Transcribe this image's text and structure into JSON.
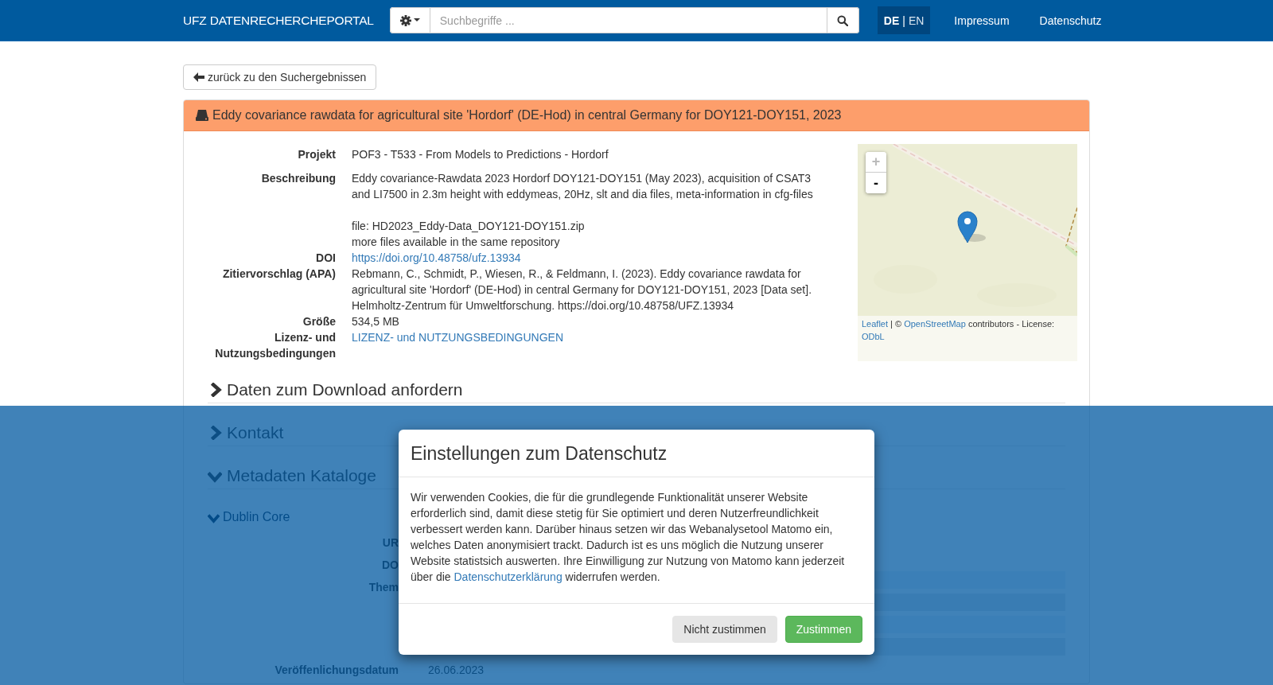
{
  "navbar": {
    "brand": "UFZ DATENRECHERCHEPORTAL",
    "search": {
      "placeholder": "Suchbegriffe ..."
    },
    "languages": [
      {
        "label": "DE",
        "selected": true
      },
      {
        "label": "EN",
        "selected": false
      }
    ],
    "language_separator": "|",
    "links": [
      "Impressum",
      "Datenschutz"
    ]
  },
  "back_button": "zurück zu den Suchergebnissen",
  "dataset": {
    "title": "Eddy covariance rawdata for agricultural site 'Hordorf' (DE-Hod) in central Germany for DOY121-DOY151, 2023",
    "fields": [
      {
        "kind": "text",
        "label": "Projekt",
        "value": "POF3 - T533 - From Models to Predictions - Hordorf"
      },
      {
        "kind": "description",
        "label": "Beschreibung",
        "paragraphs": [
          [
            "Eddy covariance-Rawdata 2023 Hordorf DOY121-DOY151 (May 2023), acquisition of CSAT3 and LI7500 in 2.3m height with eddymeas, 20Hz, slt and dia files, meta-information in cfg-files"
          ],
          [
            "file: HD2023_Eddy-Data_DOY121-DOY151.zip",
            "more files available in the same repository"
          ]
        ]
      },
      {
        "kind": "link",
        "label": "DOI",
        "value": "https://doi.org/10.48758/ufz.13934"
      },
      {
        "kind": "text",
        "label": "Zitiervorschlag (APA)",
        "value": "Rebmann, C., Schmidt, P., Wiesen, R., & Feldmann, I. (2023). Eddy covariance rawdata for agricultural site 'Hordorf' (DE-Hod) in central Germany for DOY121-DOY151, 2023 [Data set]. Helmholtz-Zentrum für Umweltforschung. https://doi.org/10.48758/UFZ.13934"
      },
      {
        "kind": "text",
        "label": "Größe",
        "value": "534,5 MB"
      },
      {
        "kind": "link",
        "label": "Lizenz- und Nutzungsbedingungen",
        "value": "LIZENZ- und NUTZUNGSBEDINGUNGEN"
      }
    ],
    "map": {
      "zoom_in": "+",
      "zoom_out": "-",
      "attribution": {
        "link1": "Leaflet",
        "middle": " | © ",
        "link2": "OpenStreetMap",
        "after": " contributors - License: ",
        "link3": "ODbL"
      }
    },
    "sections": [
      {
        "title": "Daten zum Download anfordern",
        "expanded": false
      },
      {
        "title": "Kontakt",
        "expanded": false
      },
      {
        "title": "Metadaten Kataloge",
        "expanded": true
      }
    ],
    "subsection": {
      "title": "Dublin Core",
      "expanded": true
    },
    "metadata_rows": [
      {
        "kind": "plain",
        "label": "UR"
      },
      {
        "kind": "plain",
        "label": "DO"
      },
      {
        "kind": "stripes",
        "label": "Them"
      },
      {
        "kind": "plain",
        "label": "Veröffenlichungsdatum",
        "value": "26.06.2023"
      }
    ]
  },
  "privacy_dialog": {
    "title": "Einstellungen zum Datenschutz",
    "text_before": "Wir verwenden Cookies, die für die grundlegende Funktionalität unserer Website erforderlich sind, damit diese stetig für Sie optimiert und deren Nutzerfreundlichkeit verbessert werden kann. Darüber hinaus setzen wir das Webanalysetool Matomo ein, welches Daten anonymisiert trackt. Dadurch ist es uns möglich die Nutzung unserer Website statistsich auswerten. Ihre Einwilligung zur Nutzung von Matomo kann jederzeit über die ",
    "link": "Datenschutzerklärung",
    "text_after": " widerrufen werden.",
    "buttons": [
      {
        "kind": "decline",
        "label": "Nicht zustimmen"
      },
      {
        "kind": "accept",
        "label": "Zustimmen"
      }
    ]
  }
}
